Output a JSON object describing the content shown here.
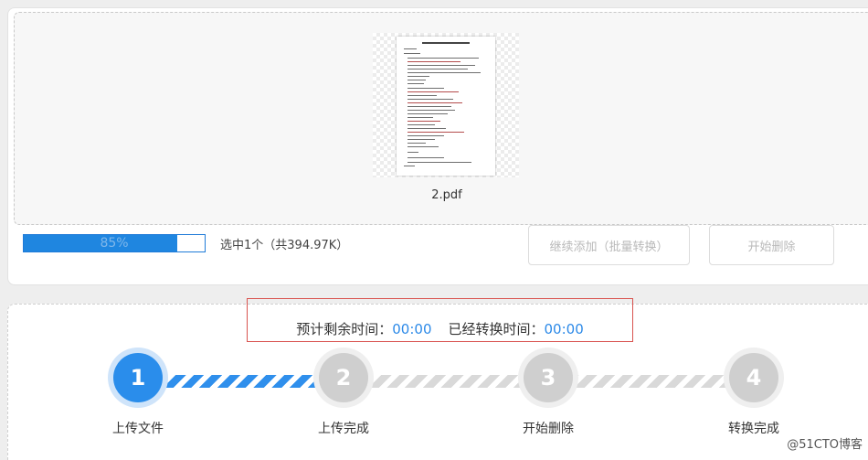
{
  "upload": {
    "file": {
      "name": "2.pdf"
    },
    "progress": {
      "value": 85,
      "label": "85%"
    },
    "selected_info": "选中1个（共394.97K）",
    "buttons": {
      "continue_label": "继续添加（批量转换）",
      "start_delete_label": "开始删除"
    }
  },
  "timing": {
    "remaining_label": "预计剩余时间：",
    "remaining_value": "00:00",
    "elapsed_label": "已经转换时间：",
    "elapsed_value": "00:00"
  },
  "steps": [
    {
      "number": "1",
      "label": "上传文件",
      "state": "active"
    },
    {
      "number": "2",
      "label": "上传完成",
      "state": "inactive"
    },
    {
      "number": "3",
      "label": "开始删除",
      "state": "inactive"
    },
    {
      "number": "4",
      "label": "转换完成",
      "state": "inactive"
    }
  ],
  "watermark": "@51CTO博客",
  "colors": {
    "accent": "#2a8deb",
    "progress_fill": "#1f86e0",
    "highlight_border": "#d9534f",
    "inactive_step": "#cfcfcf"
  }
}
